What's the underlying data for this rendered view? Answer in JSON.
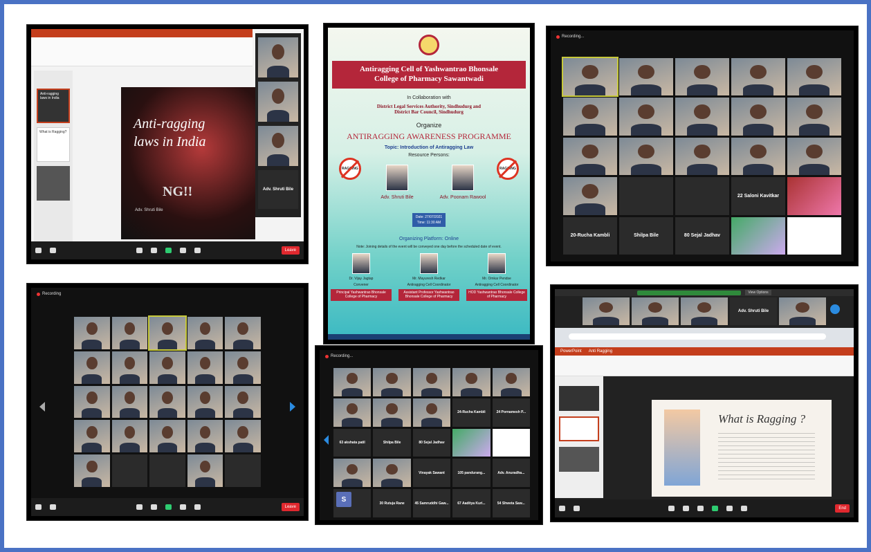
{
  "colors": {
    "frame": "#4a72c4",
    "poster_red": "#b4263a",
    "zoom_end": "#e0282e"
  },
  "shot1": {
    "slide_title_1": "Anti-ragging",
    "slide_title_2": "laws in India",
    "slide_author": "Adv. Shruti Bile",
    "ragging_text": "NG!!",
    "thumb_1": "Anti-ragging laws in India",
    "thumb_2": "What is Ragging?",
    "side_name": "Adv. Shruti Bile",
    "end_label": "Leave"
  },
  "poster": {
    "title_1": "Antiragging Cell of Yashwantrao Bhonsale",
    "title_2": "College of Pharmacy Sawantwadi",
    "collab": "In Collaboration with",
    "partners_1": "District Legal Services Authority, Sindhudurg and",
    "partners_2": "District Bar Council, Sindhudurg",
    "organize": "Organize",
    "programme": "ANTIRAGGING AWARENESS PROGRAMME",
    "topic": "Topic: Introduction of Antiragging Law",
    "resource": "Resource Persons:",
    "sign_text": "RAGGING",
    "speaker_1": "Adv. Shruti Bile",
    "speaker_2": "Adv. Poonam Rawool",
    "date": "Date: 27/07/2021",
    "time": "Time: 11:30 AM",
    "platform": "Organizing Platform: Online",
    "note": "Note: Joining details of the event will be conveyed one day before the scheduled date of event.",
    "coord_1_name": "Dr. Vijay Jagtap",
    "coord_1_role": "Convener",
    "coord_1_chip": "Principal Yashwantrao Bhonsale College of Pharmacy",
    "coord_2_name": "Mr. Mayuresh Redkar",
    "coord_2_role": "Antiragging Cell Coordinator",
    "coord_2_chip": "Assistant Professor Yashwantrao Bhonsale College of Pharmacy",
    "coord_3_name": "Mr. Omkar Pendse",
    "coord_3_role": "Antiragging Cell Coordinator",
    "coord_3_chip": "HOD Yashwantrao Bhonsale College of Pharmacy"
  },
  "shot3": {
    "recording": "Recording...",
    "name_saloni": "22 Saloni Kavitkar",
    "name_rucha": "20-Rucha Kambli",
    "name_shilpa": "Shilpa Bile",
    "name_sejal": "80 Sejal Jadhav"
  },
  "shot4": {
    "recording": "Recording",
    "end_label": "Leave"
  },
  "shot5": {
    "recording": "Recording...",
    "name_rucha": "24-Rucha Kambli",
    "name_poonam": "24 Pornamesh P...",
    "name_akshata": "63 akshata patil",
    "name_shilpa": "Shilpa Bile",
    "name_sejal": "80 Sejal Jadhav",
    "name_vinayak": "Vinayak Sawant",
    "name_pandurang": "105 pandurang...",
    "name_anuradha": "Adv. Anuradha...",
    "name_rutuja": "30 Rutuja Rane",
    "name_samruddhi": "45 Samruddhi Gaw...",
    "name_aaditya": "67 Aaditya Kuri...",
    "name_shweta": "54 Shweta Saw...",
    "avatar_letter": "S"
  },
  "shot6": {
    "top_name": "Adv. Shruti Bile",
    "app_name": "PowerPoint",
    "file_name": "Anti Ragging",
    "slide_heading": "What is Ragging ?",
    "view_options": "View Options",
    "end_label": "End"
  }
}
